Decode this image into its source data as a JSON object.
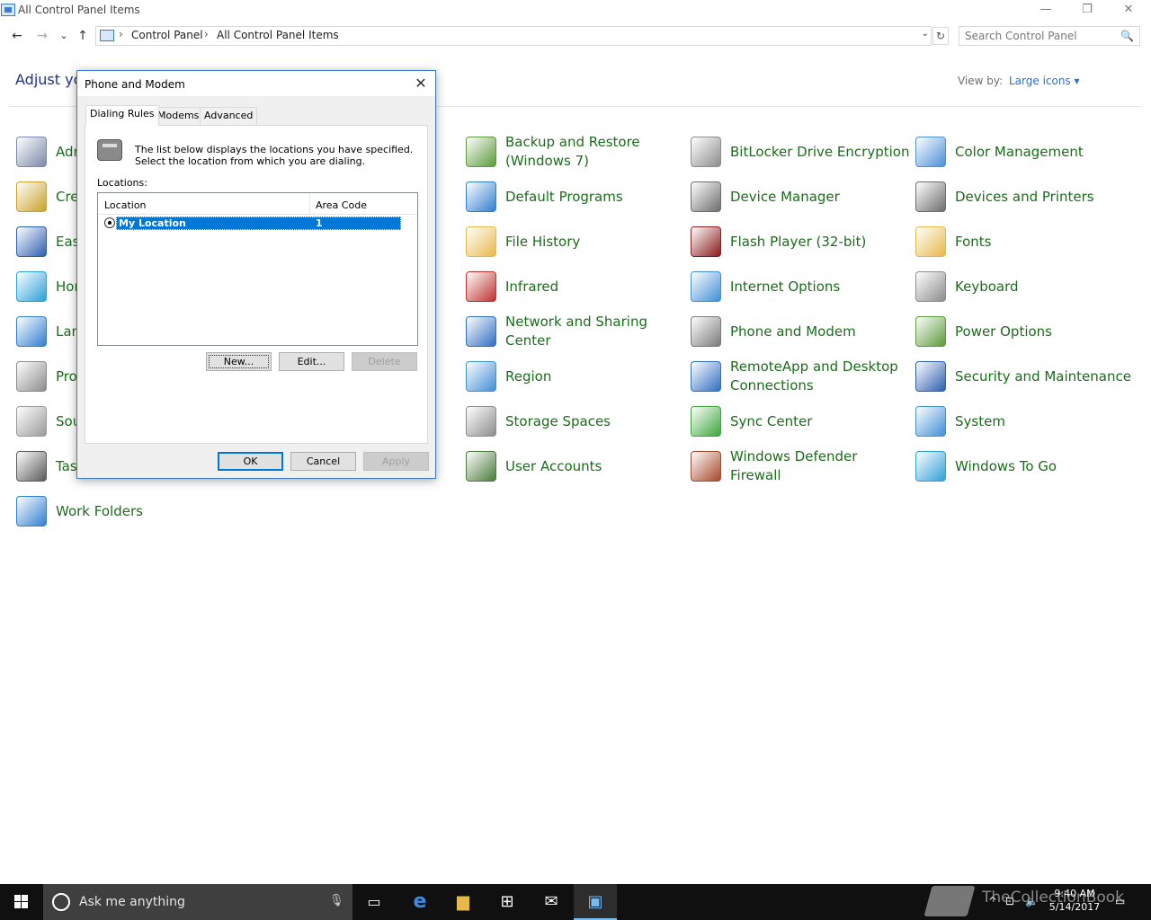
{
  "window": {
    "title": "All Control Panel Items"
  },
  "window_controls": {
    "minimize": "—",
    "restore": "❐",
    "close": "✕"
  },
  "nav": {
    "back": "←",
    "forward": "→",
    "recent": "⌄",
    "up": "↑"
  },
  "breadcrumb": {
    "items": [
      "Control Panel",
      "All Control Panel Items"
    ],
    "separator": "›",
    "dropdown": "⌄",
    "refresh": "↻"
  },
  "search": {
    "placeholder": "Search Control Panel",
    "icon": "🔍"
  },
  "heading": "Adjust you",
  "view_by": {
    "label": "View by:",
    "value": "Large icons ▾"
  },
  "items": [
    {
      "label": "Adr",
      "icon": "administrative-tools-icon",
      "color": "#7a8aa6"
    },
    {
      "label": "Backup and Restore (Windows 7)",
      "icon": "backup-restore-icon",
      "color": "#5b9a3a"
    },
    {
      "label": "BitLocker Drive Encryption",
      "icon": "bitlocker-icon",
      "color": "#8c8c8c"
    },
    {
      "label": "Color Management",
      "icon": "color-management-icon",
      "color": "#4a8fd8"
    },
    {
      "label": "Cre",
      "icon": "credential-manager-icon",
      "color": "#c9a227"
    },
    {
      "label": "Default Programs",
      "icon": "default-programs-icon",
      "color": "#2f7fd1"
    },
    {
      "label": "Device Manager",
      "icon": "device-manager-icon",
      "color": "#6d6d6d"
    },
    {
      "label": "Devices and Printers",
      "icon": "devices-printers-icon",
      "color": "#6d6d6d"
    },
    {
      "label": "Eas",
      "icon": "ease-of-access-icon",
      "color": "#2d5fb0"
    },
    {
      "label": "File History",
      "icon": "file-history-icon",
      "color": "#e7b94a"
    },
    {
      "label": "Flash Player (32-bit)",
      "icon": "flash-player-icon",
      "color": "#8b1a1a"
    },
    {
      "label": "Fonts",
      "icon": "fonts-icon",
      "color": "#e7b94a"
    },
    {
      "label": "Hor",
      "icon": "homegroup-icon",
      "color": "#2aa0d8"
    },
    {
      "label": "Infrared",
      "icon": "infrared-icon",
      "color": "#c03030"
    },
    {
      "label": "Internet Options",
      "icon": "internet-options-icon",
      "color": "#3e8fd6"
    },
    {
      "label": "Keyboard",
      "icon": "keyboard-icon",
      "color": "#8c8c8c"
    },
    {
      "label": "Lan",
      "icon": "language-icon",
      "color": "#2f7fd1"
    },
    {
      "label": "Network and Sharing Center",
      "icon": "network-sharing-icon",
      "color": "#2f6fc0"
    },
    {
      "label": "Phone and Modem",
      "icon": "phone-modem-icon",
      "color": "#7a7a7a"
    },
    {
      "label": "Power Options",
      "icon": "power-options-icon",
      "color": "#5b9a3a"
    },
    {
      "label": "Pro",
      "icon": "programs-features-icon",
      "color": "#8c8c8c"
    },
    {
      "label": "Region",
      "icon": "region-icon",
      "color": "#3e8fd6"
    },
    {
      "label": "RemoteApp and Desktop Connections",
      "icon": "remoteapp-icon",
      "color": "#2f6fc0"
    },
    {
      "label": "Security and Maintenance",
      "icon": "security-maintenance-icon",
      "color": "#2d5fb0"
    },
    {
      "label": "Sou",
      "icon": "sound-icon",
      "color": "#9a9a9a"
    },
    {
      "label": "Storage Spaces",
      "icon": "storage-spaces-icon",
      "color": "#8c8c8c"
    },
    {
      "label": "Sync Center",
      "icon": "sync-center-icon",
      "color": "#3aa63a"
    },
    {
      "label": "System",
      "icon": "system-icon",
      "color": "#3e8fd6"
    },
    {
      "label": "Tasl",
      "icon": "taskbar-navigation-icon",
      "color": "#5a5a5a"
    },
    {
      "label": "User Accounts",
      "icon": "user-accounts-icon",
      "color": "#4a7a3a"
    },
    {
      "label": "Windows Defender Firewall",
      "icon": "firewall-icon",
      "color": "#a5472a"
    },
    {
      "label": "Windows To Go",
      "icon": "windows-to-go-icon",
      "color": "#2f9fd8"
    },
    {
      "label": "Work Folders",
      "icon": "work-folders-icon",
      "color": "#2f7fd1"
    }
  ],
  "dialog": {
    "title": "Phone and Modem",
    "close": "✕",
    "tabs": [
      "Dialing Rules",
      "Modems",
      "Advanced"
    ],
    "active_tab": "Dialing Rules",
    "description": "The list below displays the locations you have specified. Select the location from which you are dialing.",
    "locations_label": "Locations:",
    "columns": [
      "Location",
      "Area Code"
    ],
    "rows": [
      {
        "location": "My Location",
        "area_code": "1",
        "selected": true
      }
    ],
    "buttons": {
      "new": "New...",
      "edit": "Edit...",
      "delete": "Delete"
    },
    "footer": {
      "ok": "OK",
      "cancel": "Cancel",
      "apply": "Apply"
    }
  },
  "taskbar": {
    "cortana_text": "Ask me anything",
    "mic": "🎙",
    "apps": [
      {
        "name": "task-view",
        "glyph": "▭"
      },
      {
        "name": "edge",
        "glyph": "e"
      },
      {
        "name": "file-explorer",
        "glyph": "▆"
      },
      {
        "name": "store",
        "glyph": "⊞"
      },
      {
        "name": "mail",
        "glyph": "✉"
      },
      {
        "name": "control-panel",
        "glyph": "▣"
      }
    ],
    "time": "9:40 AM",
    "date": "5/14/2017",
    "tray": {
      "chevron": "^",
      "network": "⊡",
      "volume": "🔈",
      "notification": "▭"
    },
    "watermark": "TheCollectionBook"
  },
  "colors": {
    "link_green": "#1b6d1b",
    "heading_blue": "#1e3287",
    "selection_blue": "#0078d7",
    "taskbar": "#101010"
  }
}
